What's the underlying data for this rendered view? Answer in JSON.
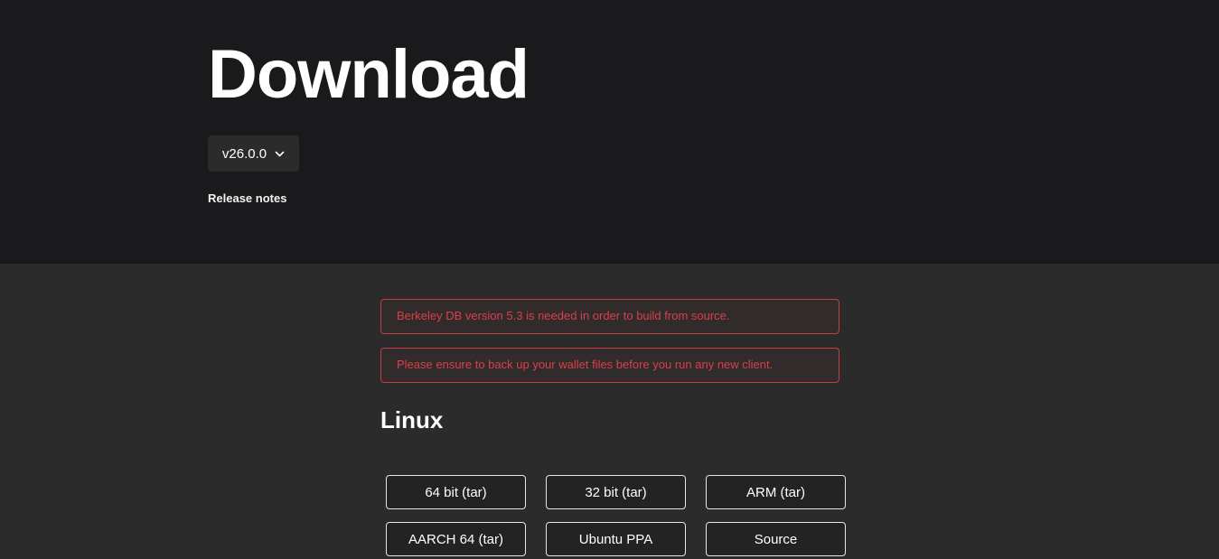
{
  "hero": {
    "title": "Download",
    "version_selector": {
      "selected": "v26.0.0",
      "icon": "chevron-down-icon"
    },
    "release_notes_label": "Release notes"
  },
  "main": {
    "warnings": [
      "Berkeley DB version 5.3 is needed in order to build from source.",
      "Please ensure to back up your wallet files before you run any new client."
    ],
    "section_title": "Linux",
    "downloads": [
      "64 bit (tar)",
      "32 bit (tar)",
      "ARM (tar)",
      "AARCH 64 (tar)",
      "Ubuntu PPA",
      "Source"
    ]
  },
  "colors": {
    "hero_background": "#1a1a1c",
    "main_background": "#2b2b2b",
    "warning_border": "#c73b44",
    "warning_text": "#d9404a",
    "button_border": "#e6e6e6",
    "button_background": "#232323",
    "text_primary": "#ffffff"
  }
}
